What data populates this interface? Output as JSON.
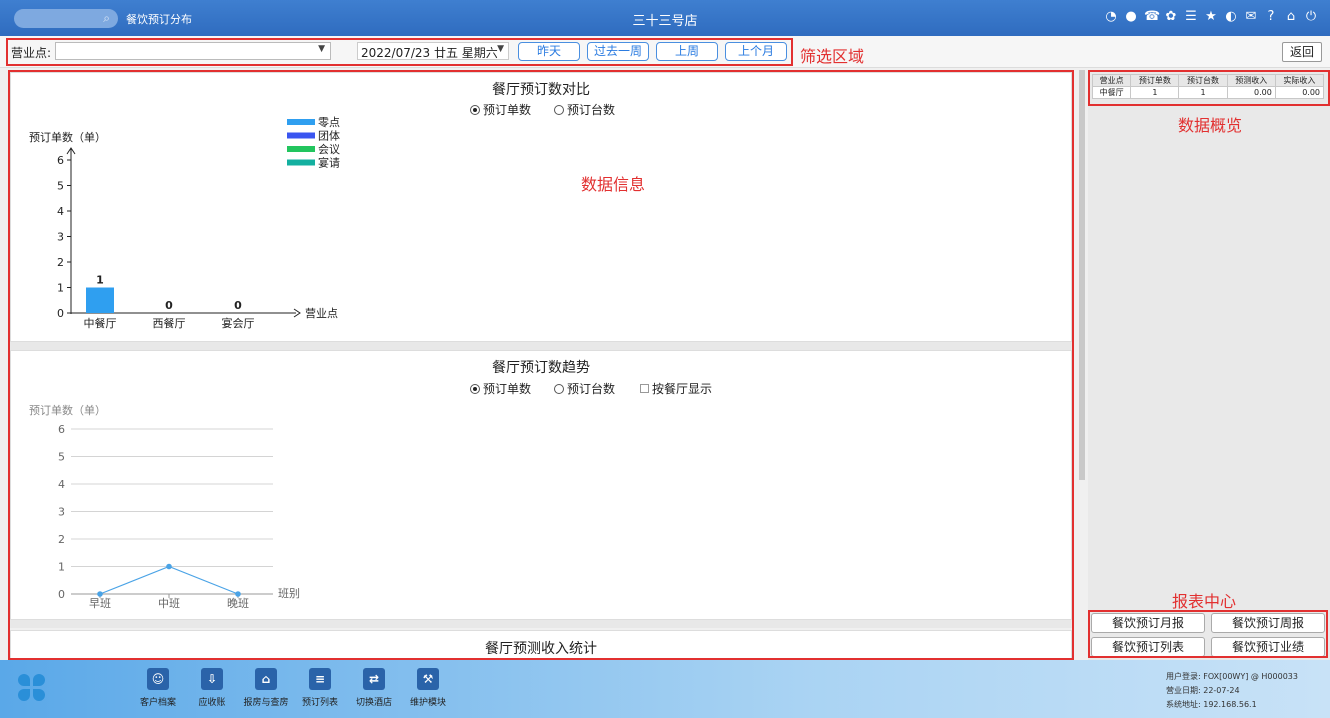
{
  "titlebar": {
    "app_name": "餐饮预订分布",
    "hotel_name": "三十三号店",
    "search_icon": "search-icon",
    "icons": [
      "wifi-icon",
      "chat-icon",
      "phone-icon",
      "palette-icon",
      "menu-icon",
      "star-icon",
      "contrast-icon",
      "mail-icon",
      "help-icon",
      "home-icon",
      "power-icon"
    ]
  },
  "filter": {
    "outlet_label": "营业点:",
    "outlet_value": "",
    "date_value": "2022/07/23  廿五  星期六",
    "quick_buttons": [
      "昨天",
      "过去一周",
      "上周",
      "上个月"
    ],
    "back_label": "返回"
  },
  "annotations": {
    "filter_area": "筛选区域",
    "data_info": "数据信息",
    "data_overview": "数据概览",
    "report_center": "报表中心"
  },
  "comparison": {
    "title": "餐厅预订数对比",
    "radio_options": [
      "预订单数",
      "预订台数"
    ],
    "radio_selected": 0
  },
  "trend": {
    "title": "餐厅预订数趋势",
    "radio_options": [
      "预订单数",
      "预订台数"
    ],
    "radio_selected": 0,
    "checkbox_label": "按餐厅显示",
    "checkbox_checked": false
  },
  "forecast": {
    "title": "餐厅预测收入统计"
  },
  "chart_data": [
    {
      "type": "bar",
      "title": "餐厅预订数对比",
      "ylabel": "预订单数（单）",
      "xlabel": "营业点",
      "categories": [
        "中餐厅",
        "西餐厅",
        "宴会厅"
      ],
      "values": [
        1,
        0,
        0
      ],
      "data_labels": [
        "1",
        "0",
        "0"
      ],
      "ylim": [
        0,
        6
      ],
      "yticks": [
        0,
        1,
        2,
        3,
        4,
        5,
        6
      ],
      "legend": [
        "零点",
        "团体",
        "会议",
        "宴请"
      ],
      "legend_colors": [
        "#2f9ff0",
        "#3a55f0",
        "#22c55e",
        "#14b0a0"
      ],
      "bar_color": "#2f9ff0",
      "legend_position": "top"
    },
    {
      "type": "line",
      "title": "餐厅预订数趋势",
      "ylabel": "预订单数（单）",
      "xlabel": "班别",
      "categories": [
        "早班",
        "中班",
        "晚班"
      ],
      "values": [
        0,
        1,
        0
      ],
      "ylim": [
        0,
        6
      ],
      "yticks": [
        0,
        1,
        2,
        3,
        4,
        5,
        6
      ],
      "line_color": "#4aa3e6",
      "grid": true
    }
  ],
  "overview": {
    "headers": [
      "营业点",
      "预订单数",
      "预订台数",
      "预测收入",
      "实际收入"
    ],
    "rows": [
      [
        "中餐厅",
        "1",
        "1",
        "0.00",
        "0.00"
      ]
    ]
  },
  "reports": [
    "餐饮预订月报",
    "餐饮预订周报",
    "餐饮预订列表",
    "餐饮预订业绩"
  ],
  "modules": [
    {
      "label": "客户档案",
      "icon": "customer-profile-icon"
    },
    {
      "label": "应收账",
      "icon": "receivable-icon"
    },
    {
      "label": "报房与查房",
      "icon": "room-report-icon"
    },
    {
      "label": "预订列表",
      "icon": "booking-list-icon"
    },
    {
      "label": "切换酒店",
      "icon": "switch-hotel-icon"
    },
    {
      "label": "维护模块",
      "icon": "maintenance-icon"
    }
  ],
  "userinfo": {
    "user": "用户登录:  FOX[00WY] @ H000033",
    "business_date": "营业日期:  22-07-24",
    "system_address": "系统地址:  192.168.56.1"
  }
}
